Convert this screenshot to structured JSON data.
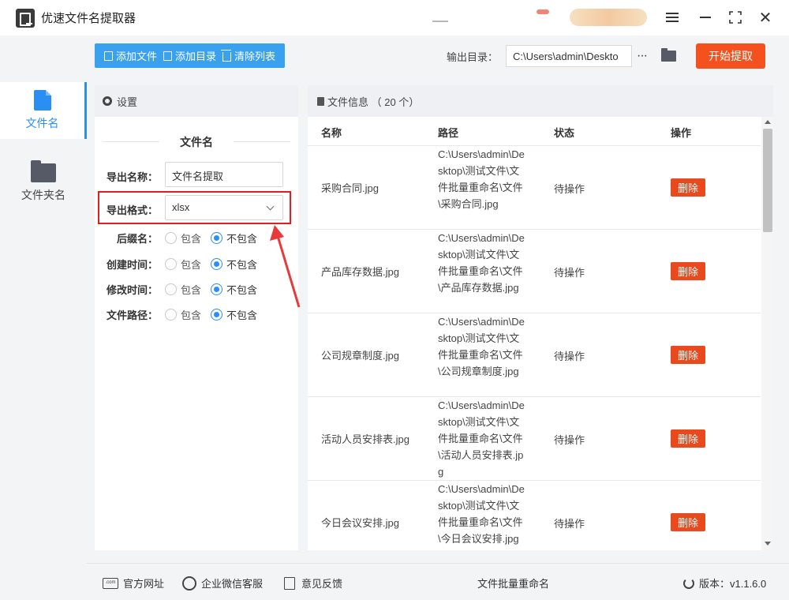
{
  "window": {
    "title": "优速文件名提取器"
  },
  "nav": {
    "items": [
      {
        "label": "文件名",
        "icon": "file-icon",
        "active": true
      },
      {
        "label": "文件夹名",
        "icon": "folder-icon",
        "active": false
      }
    ]
  },
  "toolbar": {
    "add_file": "添加文件",
    "add_dir": "添加目录",
    "clear_list": "清除列表",
    "output_label": "输出目录：",
    "output_path": "C:\\Users\\admin\\Deskto",
    "dots": "···",
    "start": "开始提取"
  },
  "settings": {
    "header": "设置",
    "section": "文件名",
    "export_name_label": "导出名称：",
    "export_name_value": "文件名提取",
    "export_format_label": "导出格式：",
    "export_format_value": "xlsx",
    "include": "包含",
    "exclude": "不包含",
    "options": [
      {
        "label": "后缀名：",
        "selected": "exclude"
      },
      {
        "label": "创建时间：",
        "selected": "exclude"
      },
      {
        "label": "修改时间：",
        "selected": "exclude"
      },
      {
        "label": "文件路径：",
        "selected": "exclude"
      }
    ]
  },
  "filepanel": {
    "header": "文件信息 （ 20 个）",
    "columns": {
      "name": "名称",
      "path": "路径",
      "status": "状态",
      "action": "操作"
    },
    "rows": [
      {
        "name": "采购合同.jpg",
        "path": "C:\\Users\\admin\\Desktop\\测试文件\\文件批量重命名\\文件\\采购合同.jpg",
        "status": "待操作",
        "action": "删除"
      },
      {
        "name": "产品库存数据.jpg",
        "path": "C:\\Users\\admin\\Desktop\\测试文件\\文件批量重命名\\文件\\产品库存数据.jpg",
        "status": "待操作",
        "action": "删除"
      },
      {
        "name": "公司规章制度.jpg",
        "path": "C:\\Users\\admin\\Desktop\\测试文件\\文件批量重命名\\文件\\公司规章制度.jpg",
        "status": "待操作",
        "action": "删除"
      },
      {
        "name": "活动人员安排表.jpg",
        "path": "C:\\Users\\admin\\Desktop\\测试文件\\文件批量重命名\\文件\\活动人员安排表.jpg",
        "status": "待操作",
        "action": "删除"
      },
      {
        "name": "今日会议安排.jpg",
        "path": "C:\\Users\\admin\\Desktop\\测试文件\\文件批量重命名\\文件\\今日会议安排.jpg",
        "status": "待操作",
        "action": "删除"
      }
    ]
  },
  "footer": {
    "website": "官方网址",
    "wechat": "企业微信客服",
    "feedback": "意见反馈",
    "center": "文件批量重命名",
    "version": "版本：v1.1.6.0"
  },
  "colors": {
    "accent": "#2b8ef3",
    "toolbar_button": "#3aa1ef",
    "start_button": "#f4511e",
    "delete_button": "#e8491d",
    "highlight": "#e02020"
  }
}
